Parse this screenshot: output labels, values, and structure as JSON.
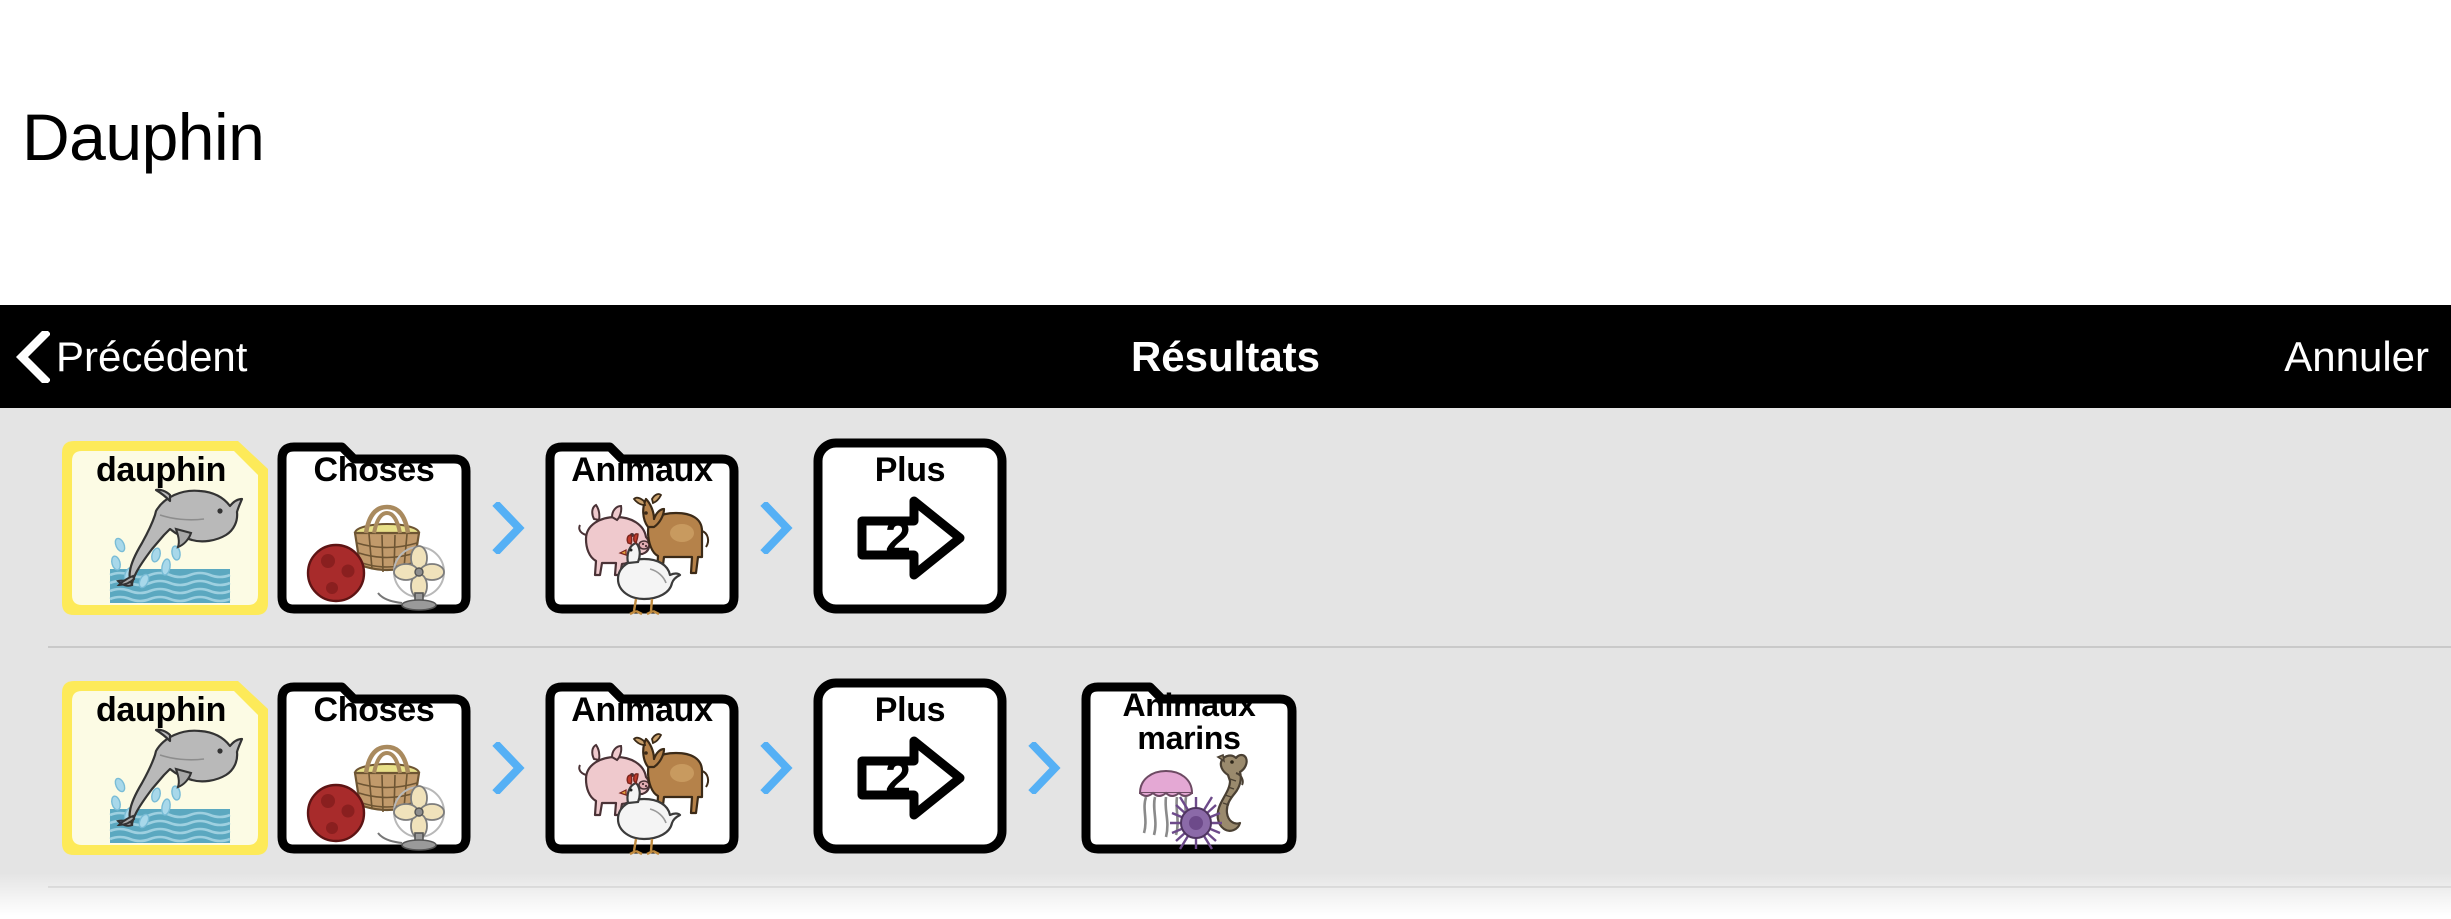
{
  "page": {
    "title": "Dauphin",
    "background": "#ffffff",
    "list_background": "#e4e4e4"
  },
  "navbar": {
    "background": "#000000",
    "back_label": "Précédent",
    "back_icon": "chevron-left-icon",
    "title": "Résultats",
    "cancel_label": "Annuler"
  },
  "separator": {
    "icon": "chevron-right-icon",
    "color": "#55b0f5"
  },
  "results": [
    {
      "path": [
        {
          "type": "symbol",
          "label": "dauphin",
          "art": "dolphin-jumping-over-water",
          "border_color": "#fdea59",
          "fill_color": "#fcfbe4"
        },
        {
          "type": "folder",
          "label": "Choses",
          "art": "basket-ball-fan",
          "border_color": "#000000",
          "fill_color": "#ffffff"
        },
        {
          "type": "folder",
          "label": "Animaux",
          "art": "pig-cow-chicken",
          "border_color": "#000000",
          "fill_color": "#ffffff"
        },
        {
          "type": "more",
          "label": "Plus",
          "art": "arrow-right-with-number",
          "badge": "2",
          "border_color": "#000000",
          "fill_color": "#ffffff"
        }
      ]
    },
    {
      "path": [
        {
          "type": "symbol",
          "label": "dauphin",
          "art": "dolphin-jumping-over-water",
          "border_color": "#fdea59",
          "fill_color": "#fcfbe4"
        },
        {
          "type": "folder",
          "label": "Choses",
          "art": "basket-ball-fan",
          "border_color": "#000000",
          "fill_color": "#ffffff"
        },
        {
          "type": "folder",
          "label": "Animaux",
          "art": "pig-cow-chicken",
          "border_color": "#000000",
          "fill_color": "#ffffff"
        },
        {
          "type": "more",
          "label": "Plus",
          "art": "arrow-right-with-number",
          "badge": "2",
          "border_color": "#000000",
          "fill_color": "#ffffff"
        },
        {
          "type": "folder",
          "label": "Animaux marins",
          "label_line1": "Animaux",
          "label_line2": "marins",
          "art": "jellyfish-seahorse-urchin",
          "border_color": "#000000",
          "fill_color": "#ffffff"
        }
      ]
    }
  ]
}
